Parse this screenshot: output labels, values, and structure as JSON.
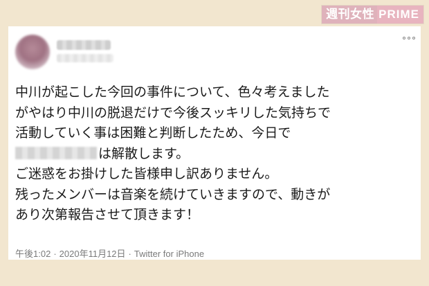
{
  "watermark": {
    "left": "週刊女性",
    "right": "PRIME"
  },
  "tweet": {
    "lines": [
      "中川が起こした今回の事件について、色々考えました",
      "がやはり中川の脱退だけで今後スッキリした気持ちで",
      "活動していく事は困難と判断したため、今日で",
      "は解散します。",
      "ご迷惑をお掛けした皆様申し訳ありません。",
      "残ったメンバーは音楽を続けていきますので、動きが",
      "あり次第報告させて頂きます！"
    ]
  },
  "meta": {
    "time": "午後1:02",
    "separator1": "·",
    "date": "2020年11月12日",
    "separator2": "·",
    "source": "Twitter for iPhone"
  },
  "icons": [
    "more-options-icon"
  ]
}
